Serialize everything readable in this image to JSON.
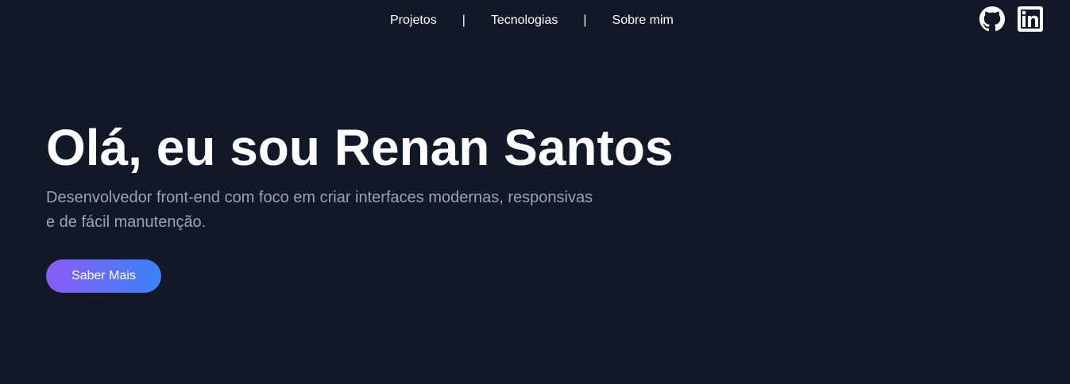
{
  "nav": {
    "links": [
      {
        "label": "Projetos"
      },
      {
        "label": "Tecnologias"
      },
      {
        "label": "Sobre mim"
      }
    ],
    "separator": "|",
    "social": [
      {
        "icon": "github-icon"
      },
      {
        "icon": "linkedin-icon"
      }
    ]
  },
  "hero": {
    "title": "Olá, eu sou Renan Santos",
    "subtitle_line1": "Desenvolvedor front-end com foco em criar interfaces modernas, responsivas",
    "subtitle_line2": "e de fácil manutenção.",
    "cta_label": "Saber Mais"
  },
  "colors": {
    "background": "#111827",
    "text": "#ffffff",
    "muted_text": "#9ca3af",
    "gradient_start": "#8b5cf6",
    "gradient_end": "#3b82f6"
  }
}
